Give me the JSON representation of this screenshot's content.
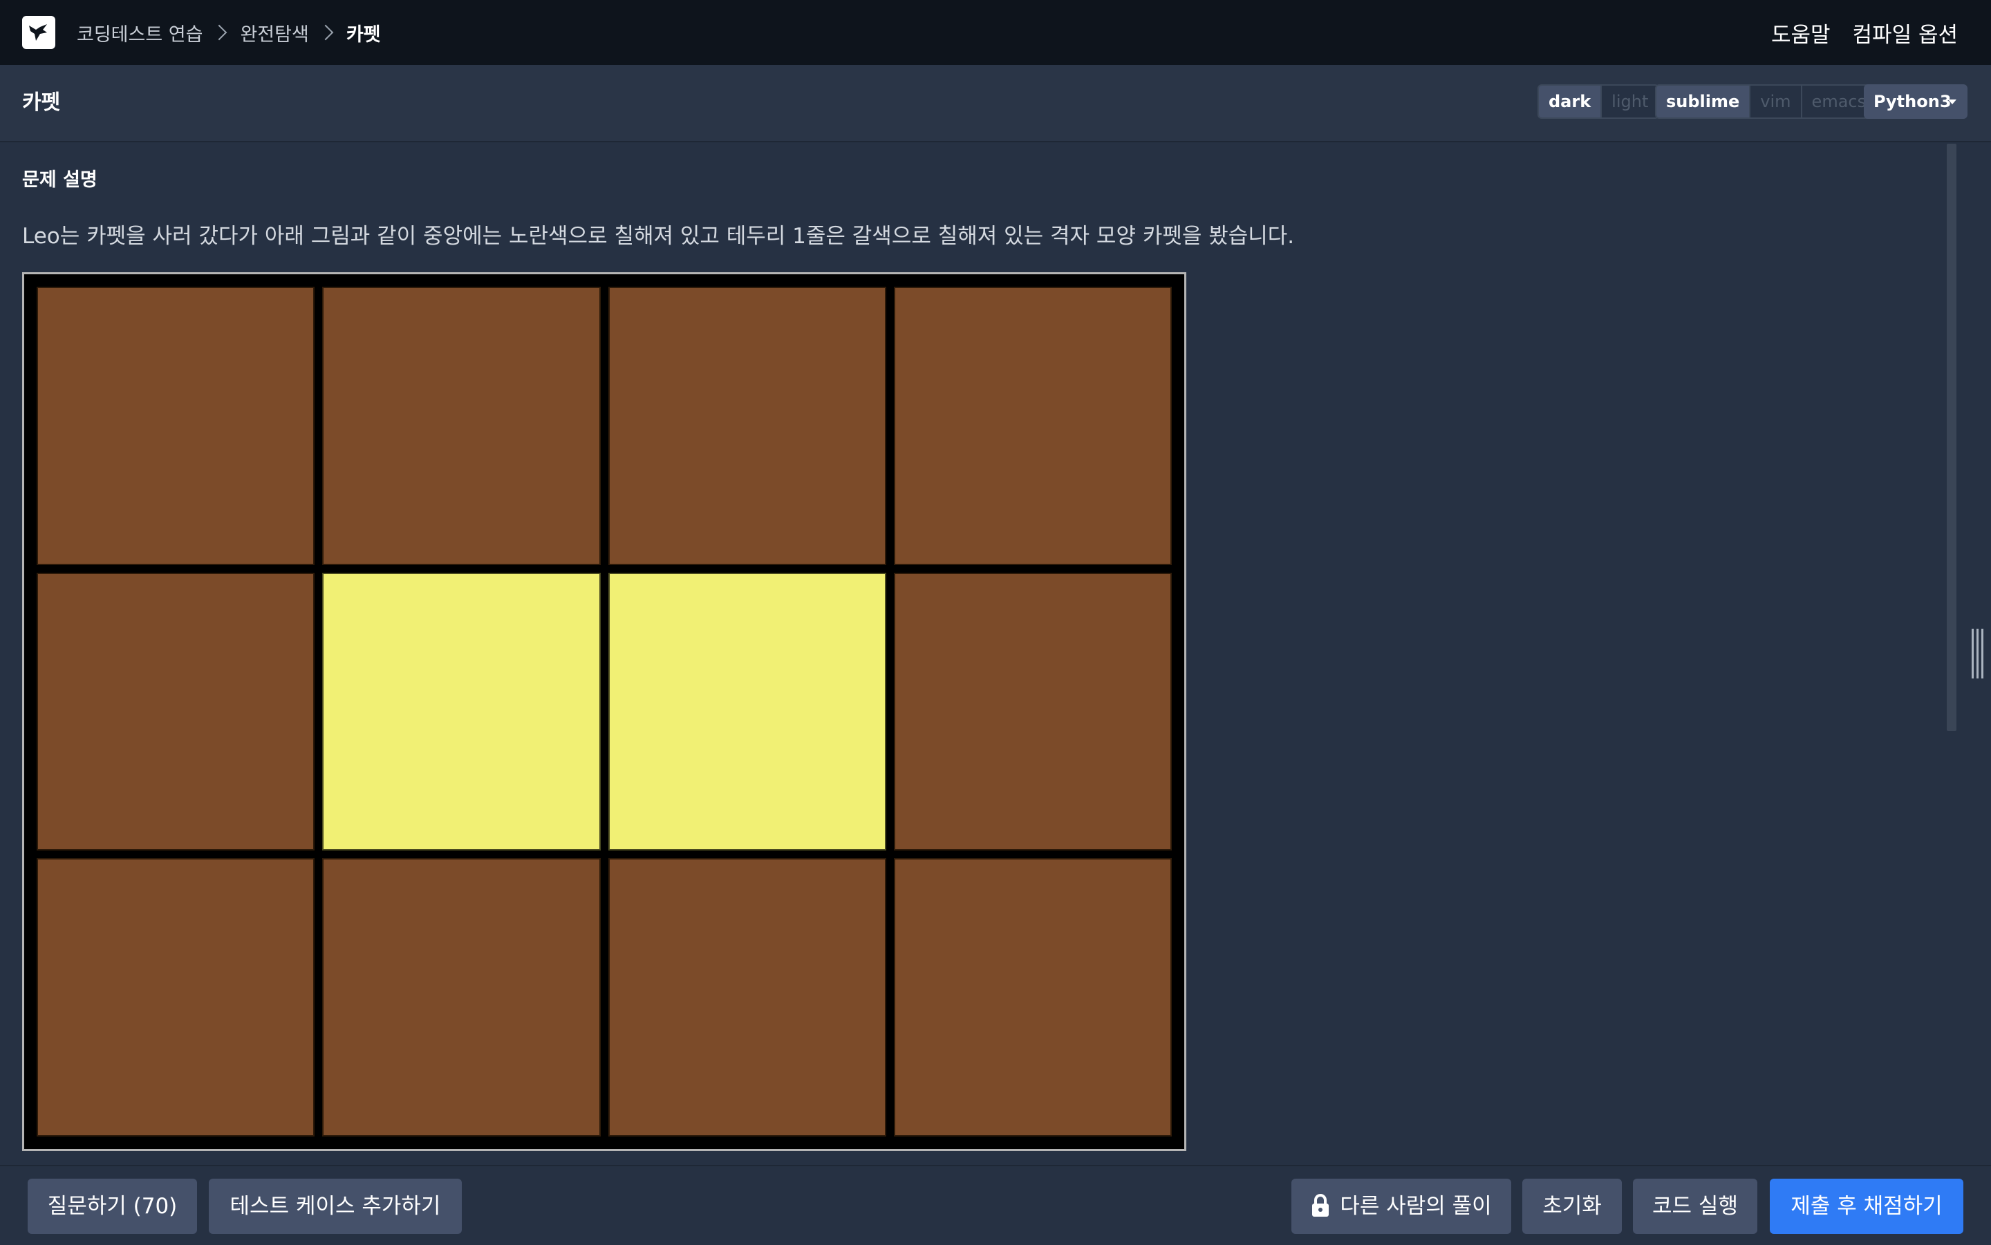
{
  "nav": {
    "breadcrumb": [
      "코딩테스트 연습",
      "완전탐색",
      "카펫"
    ],
    "links": [
      "도움말",
      "컴파일 옵션"
    ]
  },
  "header": {
    "title": "카펫",
    "theme_options": [
      "dark",
      "light"
    ],
    "theme_selected": "dark",
    "keymap_options": [
      "sublime",
      "vim",
      "emacs"
    ],
    "keymap_selected": "sublime",
    "language": "Python3"
  },
  "problem": {
    "section_title": "문제 설명",
    "description": "Leo는 카펫을 사러 갔다가 아래 그림과 같이 중앙에는 노란색으로 칠해져 있고 테두리 1줄은 갈색으로 칠해져 있는 격자 모양 카펫을 봤습니다.",
    "carpet_grid": [
      [
        "brown",
        "brown",
        "brown",
        "brown"
      ],
      [
        "brown",
        "yellow",
        "yellow",
        "brown"
      ],
      [
        "brown",
        "brown",
        "brown",
        "brown"
      ]
    ],
    "colors": {
      "brown": "#7c4b29",
      "yellow": "#f1f074"
    }
  },
  "footer": {
    "ask_button": "질문하기 (70)",
    "add_testcase_button": "테스트 케이스 추가하기",
    "others_solution_button": "다른 사람의 풀이",
    "reset_button": "초기화",
    "run_button": "코드 실행",
    "submit_button": "제출 후 채점하기",
    "accent_color": "#2f7bf5"
  }
}
